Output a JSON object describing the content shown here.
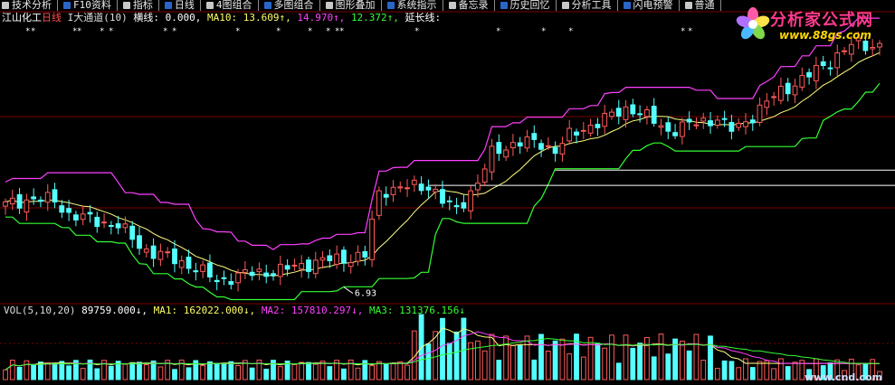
{
  "toolbar": {
    "items": [
      {
        "label": "技术分析",
        "icon": "technical-icon"
      },
      {
        "label": "F10资料",
        "icon": "f10-icon"
      },
      {
        "label": "指标",
        "icon": "indicator-icon"
      },
      {
        "label": "日线",
        "icon": "dayline-icon"
      },
      {
        "label": "4图组合",
        "icon": "four-chart-icon"
      },
      {
        "label": "多图组合",
        "icon": "multi-chart-icon"
      },
      {
        "label": "图形叠加",
        "icon": "overlay-icon"
      },
      {
        "label": "系统指示",
        "icon": "system-icon"
      },
      {
        "label": "备忘录",
        "icon": "memo-icon"
      },
      {
        "label": "历史回忆",
        "icon": "history-icon"
      },
      {
        "label": "分析工具",
        "icon": "tools-icon"
      },
      {
        "label": "闪电预警",
        "icon": "alert-icon"
      },
      {
        "label": "普通",
        "icon": "normal-icon"
      }
    ]
  },
  "price_header": {
    "stock": "江山化工",
    "period": "日线",
    "indicator": "I大通道(10)",
    "hline_label": "横线: 0.000,",
    "ma10_label": "MA10: 13.609↑,",
    "upper_value": "14.970↑,",
    "lower_value": "12.372↑,",
    "extend_label": "延长线:"
  },
  "low_label": "6.93",
  "vol_header": {
    "name": "VOL(5,10,20)",
    "value": "89759.000↓,",
    "ma1": "MA1: 162022.000↓,",
    "ma2": "MA2: 157810.297↓,",
    "ma3": "MA3: 131376.156↓"
  },
  "logo": {
    "brand": "分析家公式网",
    "site": "www.88gs.com"
  },
  "watermark": "www.cnd.com",
  "colors": {
    "up": "#ff5a5a",
    "down": "#54ffff",
    "upper_band": "#ff40ff",
    "lower_band": "#33ff33",
    "ma_line": "#ffff80",
    "grid": "#7a0000",
    "header_yellow": "#ffff66"
  },
  "chart_data": {
    "type": "candlestick",
    "title": "江山化工 日线",
    "price_range": [
      6.5,
      18.5
    ],
    "candles_count": 125,
    "ma10": 13.609,
    "upper_channel": 14.97,
    "lower_channel": 12.372,
    "low_marker": 6.93,
    "volume": {
      "value": 89759,
      "ma1": 162022,
      "ma2": 157810.297,
      "ma3": 131376.156
    }
  }
}
